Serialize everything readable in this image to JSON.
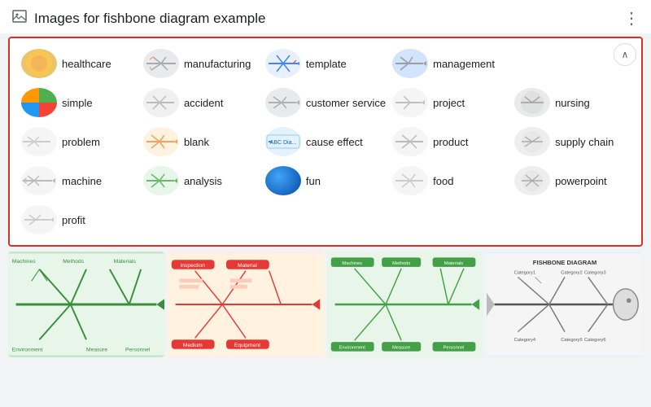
{
  "header": {
    "title": "Images for fishbone diagram example",
    "more_icon": "⋮",
    "image_icon": "🖼"
  },
  "collapse_button": "∧",
  "tags": [
    {
      "id": "healthcare",
      "label": "healthcare",
      "thumb_class": "thumb-healthcare"
    },
    {
      "id": "manufacturing",
      "label": "manufacturing",
      "thumb_class": "thumb-manufacturing"
    },
    {
      "id": "template",
      "label": "template",
      "thumb_class": "thumb-template"
    },
    {
      "id": "management",
      "label": "management",
      "thumb_class": "thumb-management"
    },
    {
      "id": "simple",
      "label": "simple",
      "thumb_class": "thumb-simple"
    },
    {
      "id": "accident",
      "label": "accident",
      "thumb_class": "thumb-accident"
    },
    {
      "id": "customer-service",
      "label": "customer service",
      "thumb_class": "thumb-customer-service"
    },
    {
      "id": "project",
      "label": "project",
      "thumb_class": "thumb-project"
    },
    {
      "id": "nursing",
      "label": "nursing",
      "thumb_class": "thumb-nursing"
    },
    {
      "id": "problem",
      "label": "problem",
      "thumb_class": "thumb-problem"
    },
    {
      "id": "blank",
      "label": "blank",
      "thumb_class": "thumb-blank"
    },
    {
      "id": "cause-effect",
      "label": "cause effect",
      "thumb_class": "thumb-cause-effect"
    },
    {
      "id": "product",
      "label": "product",
      "thumb_class": "thumb-product"
    },
    {
      "id": "supply-chain",
      "label": "supply chain",
      "thumb_class": "thumb-supply-chain"
    },
    {
      "id": "machine",
      "label": "machine",
      "thumb_class": "thumb-machine"
    },
    {
      "id": "analysis",
      "label": "analysis",
      "thumb_class": "thumb-analysis"
    },
    {
      "id": "fun",
      "label": "fun",
      "thumb_class": "thumb-fun"
    },
    {
      "id": "food",
      "label": "food",
      "thumb_class": "thumb-food"
    },
    {
      "id": "powerpoint",
      "label": "powerpoint",
      "thumb_class": "thumb-powerpoint"
    },
    {
      "id": "profit",
      "label": "profit",
      "thumb_class": "thumb-profit"
    }
  ],
  "bottom_images": [
    {
      "id": "img1",
      "alt": "fishbone diagram 1",
      "type": "green-fishbone"
    },
    {
      "id": "img2",
      "alt": "fishbone diagram 2",
      "type": "red-fishbone"
    },
    {
      "id": "img3",
      "alt": "fishbone diagram 3",
      "type": "green-fishbone-2"
    },
    {
      "id": "img4",
      "alt": "fishbone diagram 4",
      "type": "classic-fishbone"
    }
  ]
}
